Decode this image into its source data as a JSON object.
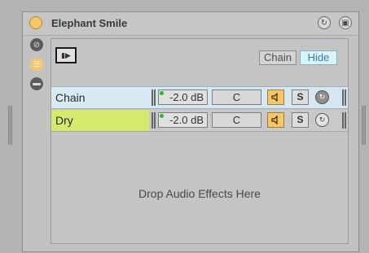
{
  "device": {
    "title": "Elephant Smile",
    "title_icons": [
      "hot-swap-icon",
      "save-icon"
    ],
    "side_buttons": [
      "macro-icon",
      "chain-list-icon",
      "device-toggle-icon"
    ]
  },
  "toolbar": {
    "chain_label": "Chain",
    "hide_label": "Hide"
  },
  "chains": [
    {
      "name": "Chain",
      "volume": "-2.0 dB",
      "pan": "C",
      "solo": "S"
    },
    {
      "name": "Dry",
      "volume": "-2.0 dB",
      "pan": "C",
      "solo": "S"
    }
  ],
  "drop_hint": "Drop Audio Effects Here",
  "colors": {
    "accent": "#f6c76a",
    "selected_row": "#d8ebf5",
    "dry_chain": "#d3ea6c",
    "hide_button": "#dbf3fb"
  }
}
